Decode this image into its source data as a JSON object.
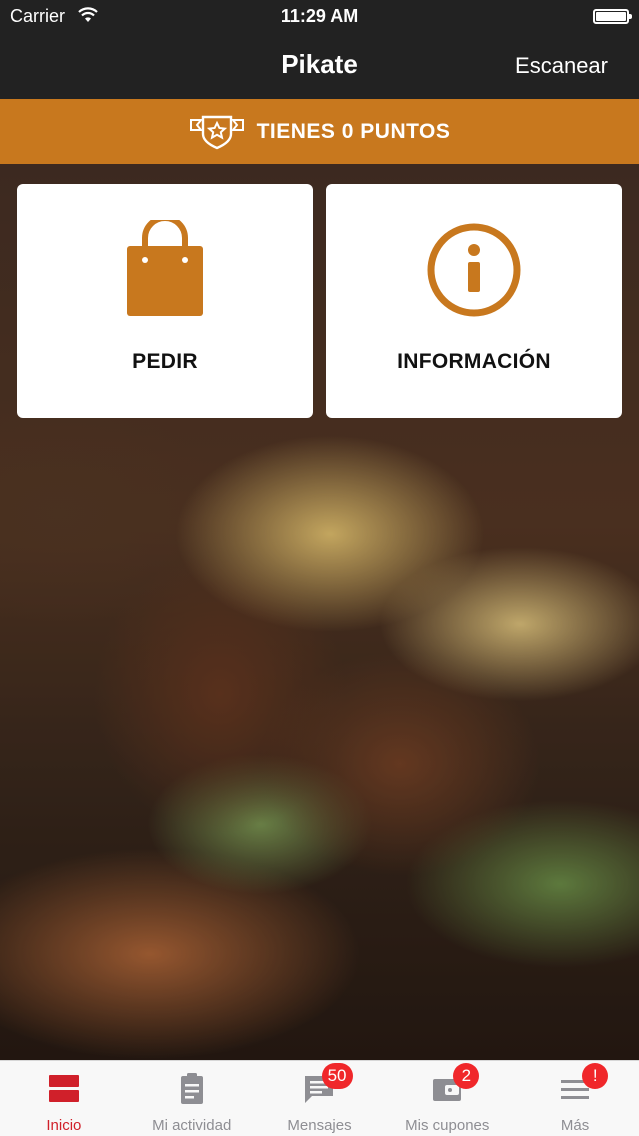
{
  "status_bar": {
    "carrier": "Carrier",
    "time": "11:29 AM"
  },
  "nav": {
    "title": "Pikate",
    "action_label": "Escanear"
  },
  "points_banner": {
    "text": "TIENES 0 PUNTOS"
  },
  "cards": [
    {
      "label": "PEDIR",
      "icon": "shopping-bag-icon"
    },
    {
      "label": "INFORMACIÓN",
      "icon": "info-icon"
    }
  ],
  "tabs": [
    {
      "label": "Inicio",
      "icon": "home-icon",
      "active": true
    },
    {
      "label": "Mi actividad",
      "icon": "clipboard-icon",
      "active": false
    },
    {
      "label": "Mensajes",
      "icon": "chat-icon",
      "badge": "50"
    },
    {
      "label": "Mis cupones",
      "icon": "wallet-icon",
      "badge": "2"
    },
    {
      "label": "Más",
      "icon": "menu-icon",
      "badge": "!"
    }
  ],
  "colors": {
    "accent": "#c8781e",
    "active_tab": "#d0202a",
    "badge": "#f0272a",
    "bar": "#222222"
  }
}
